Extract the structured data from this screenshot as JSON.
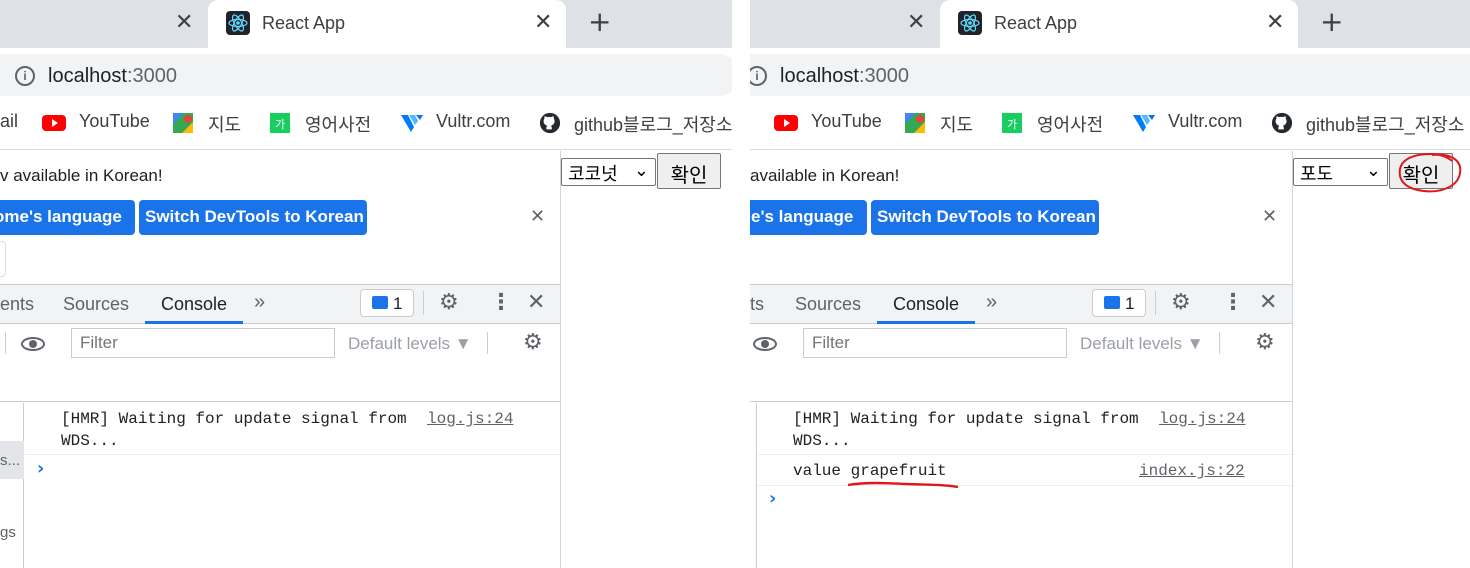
{
  "tab_title": "React App",
  "address": {
    "host": "localhost",
    "port": ":3000"
  },
  "bookmarks": {
    "gmail_fragment": "ail",
    "youtube": "YouTube",
    "maps": "지도",
    "dictionary": "영어사전",
    "vultr": "Vultr.com",
    "github": "github블로그_저장소"
  },
  "devtools": {
    "banner_text_left": "v available in Korean!",
    "banner_text_right": "available in Korean!",
    "btn_language_left": "ome's language",
    "btn_language_right": "e's language",
    "btn_switch": "Switch DevTools to Korean",
    "tabs": {
      "elements_frag_left": "ents",
      "elements_frag_right": "ts",
      "sources": "Sources",
      "console": "Console"
    },
    "issues_count": "1",
    "filter_placeholder": "Filter",
    "levels": "Default levels ▼",
    "sidebar_frag": {
      "item1": "s...",
      "item2": "gs"
    }
  },
  "console_left": {
    "log1": "[HMR] Waiting for update signal from\nWDS...",
    "log1_src": "log.js:24"
  },
  "console_right": {
    "log1": "[HMR] Waiting for update signal from\nWDS...",
    "log1_src": "log.js:24",
    "log2_label": "value",
    "log2_value": "grapefruit",
    "log2_src": "index.js:22"
  },
  "page_left": {
    "select_value": "코코넛",
    "button": "확인"
  },
  "page_right": {
    "select_value": "포도",
    "button": "확인"
  },
  "colors": {
    "accent": "#1a73e8",
    "annotation": "#e0161b",
    "tabstrip": "#dee1e6"
  }
}
